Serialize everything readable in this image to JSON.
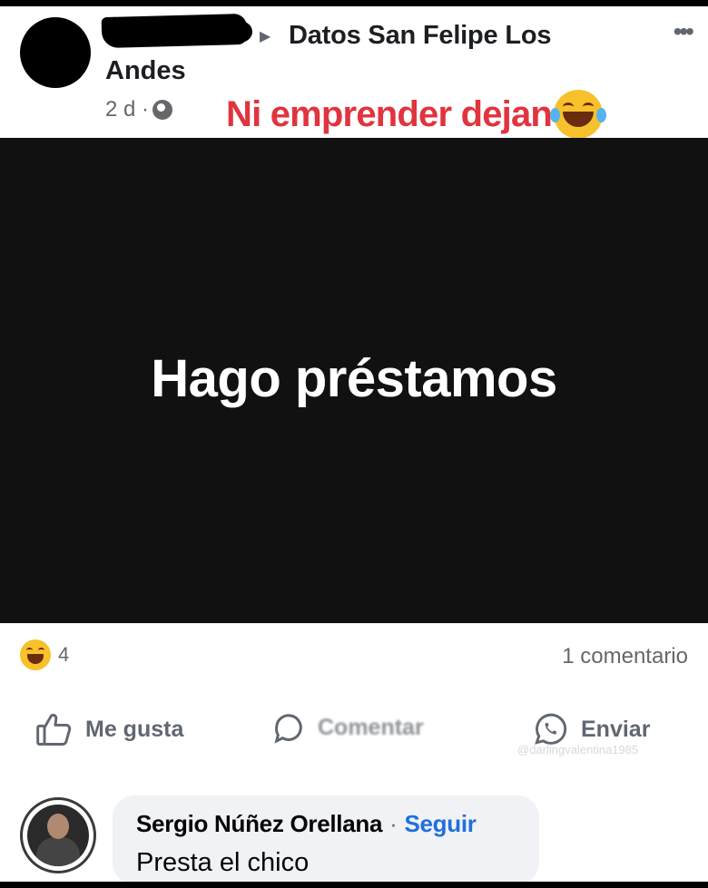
{
  "header": {
    "group_line1": "Datos San Felipe Los",
    "group_line2": "Andes",
    "time": "2 d ·",
    "more": "•••"
  },
  "caption": {
    "text": "Ni emprender dejan",
    "emoji": "face-with-tears-of-joy-icon"
  },
  "post": {
    "image_text": "Hago préstamos",
    "background": "#111111"
  },
  "stats": {
    "reaction_count": "4",
    "comments": "1 comentario"
  },
  "actions": {
    "like": "Me gusta",
    "comment": "Comentar",
    "share": "Enviar"
  },
  "watermark": "@darlingvalentina1985",
  "comment": {
    "author": "Sergio Núñez Orellana",
    "separator": "·",
    "follow": "Seguir",
    "text": "Presta el chico"
  },
  "colors": {
    "caption": "#e0343f",
    "follow_link": "#216fdb",
    "muted": "#65676b"
  }
}
